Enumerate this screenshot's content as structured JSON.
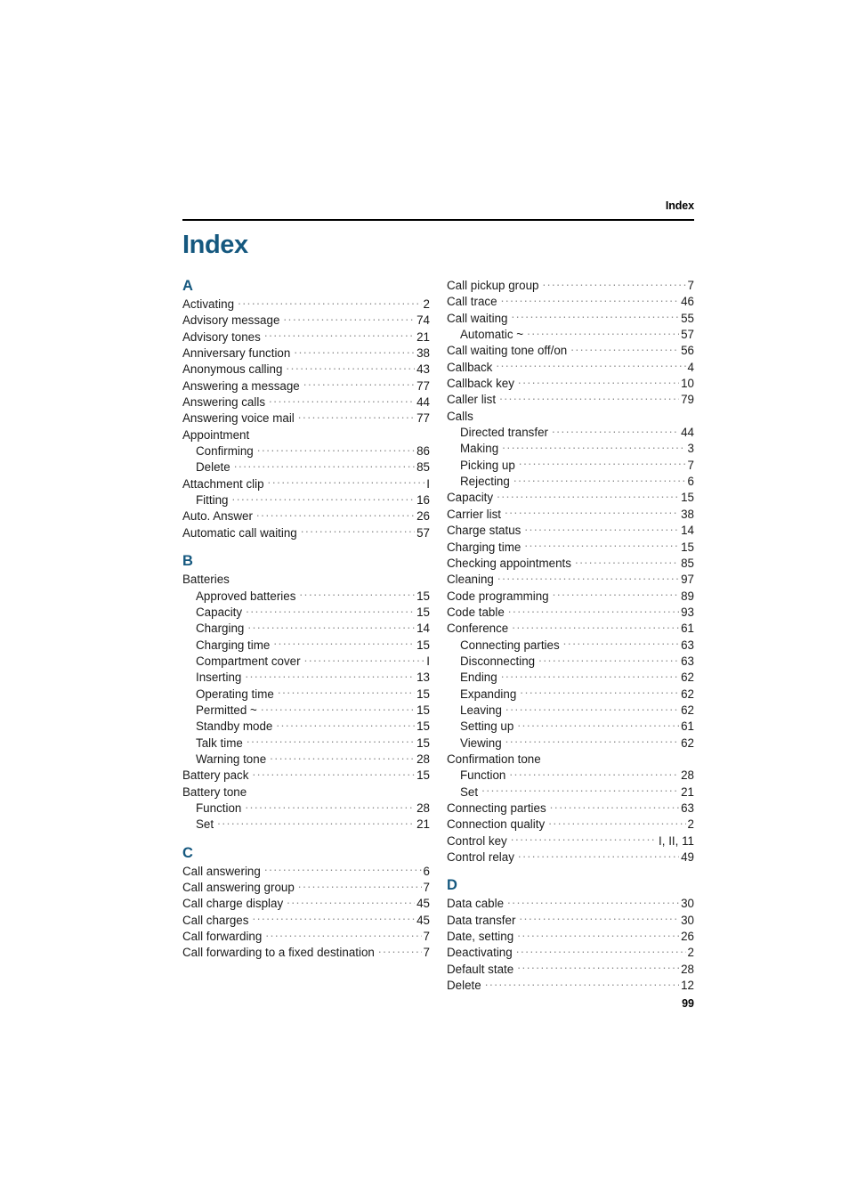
{
  "header": {
    "running_title": "Index"
  },
  "title": "Index",
  "folio": {
    "page_number": "99"
  },
  "colors": {
    "accent_blue": "#15587f",
    "text": "#1a1a1a",
    "leader_dots": "#8c8c8c",
    "rule": "#000000"
  },
  "columns": [
    {
      "name": "left-column",
      "sections": [
        {
          "letter": "A",
          "entries": [
            {
              "label": "Activating",
              "page": "2",
              "sub": false
            },
            {
              "label": "Advisory message",
              "page": "74",
              "sub": false
            },
            {
              "label": "Advisory tones",
              "page": "21",
              "sub": false
            },
            {
              "label": "Anniversary function",
              "page": "38",
              "sub": false
            },
            {
              "label": "Anonymous calling",
              "page": "43",
              "sub": false
            },
            {
              "label": "Answering a message",
              "page": "77",
              "sub": false
            },
            {
              "label": "Answering calls",
              "page": "44",
              "sub": false
            },
            {
              "label": "Answering voice mail",
              "page": "77",
              "sub": false
            },
            {
              "label": "Appointment",
              "page": "",
              "sub": false
            },
            {
              "label": "Confirming",
              "page": "86",
              "sub": true
            },
            {
              "label": "Delete",
              "page": "85",
              "sub": true
            },
            {
              "label": "Attachment clip",
              "page": "I",
              "sub": false
            },
            {
              "label": "Fitting",
              "page": "16",
              "sub": true
            },
            {
              "label": "Auto. Answer",
              "page": "26",
              "sub": false
            },
            {
              "label": "Automatic call waiting",
              "page": "57",
              "sub": false
            }
          ]
        },
        {
          "letter": "B",
          "entries": [
            {
              "label": "Batteries",
              "page": "",
              "sub": false
            },
            {
              "label": "Approved batteries",
              "page": "15",
              "sub": true
            },
            {
              "label": "Capacity",
              "page": "15",
              "sub": true
            },
            {
              "label": "Charging",
              "page": "14",
              "sub": true
            },
            {
              "label": "Charging time",
              "page": "15",
              "sub": true
            },
            {
              "label": "Compartment cover",
              "page": "I",
              "sub": true
            },
            {
              "label": "Inserting",
              "page": "13",
              "sub": true
            },
            {
              "label": "Operating time",
              "page": "15",
              "sub": true
            },
            {
              "label": "Permitted ~",
              "page": "15",
              "sub": true
            },
            {
              "label": "Standby mode",
              "page": "15",
              "sub": true
            },
            {
              "label": "Talk time",
              "page": "15",
              "sub": true
            },
            {
              "label": "Warning tone",
              "page": "28",
              "sub": true
            },
            {
              "label": "Battery pack",
              "page": "15",
              "sub": false
            },
            {
              "label": "Battery tone",
              "page": "",
              "sub": false
            },
            {
              "label": "Function",
              "page": "28",
              "sub": true
            },
            {
              "label": "Set",
              "page": "21",
              "sub": true
            }
          ]
        },
        {
          "letter": "C",
          "entries": [
            {
              "label": "Call answering",
              "page": "6",
              "sub": false
            },
            {
              "label": "Call answering group",
              "page": "7",
              "sub": false
            },
            {
              "label": "Call charge display",
              "page": "45",
              "sub": false
            },
            {
              "label": "Call charges",
              "page": "45",
              "sub": false
            },
            {
              "label": "Call forwarding",
              "page": "7",
              "sub": false
            },
            {
              "label": "Call forwarding to a fixed destination",
              "page": "7",
              "sub": false
            }
          ]
        }
      ]
    },
    {
      "name": "right-column",
      "sections": [
        {
          "letter": "",
          "entries": [
            {
              "label": "Call pickup group",
              "page": "7",
              "sub": false
            },
            {
              "label": "Call trace",
              "page": "46",
              "sub": false
            },
            {
              "label": "Call waiting",
              "page": "55",
              "sub": false
            },
            {
              "label": "Automatic ~",
              "page": "57",
              "sub": true
            },
            {
              "label": "Call waiting tone off/on",
              "page": "56",
              "sub": false
            },
            {
              "label": "Callback",
              "page": "4",
              "sub": false
            },
            {
              "label": "Callback key",
              "page": "10",
              "sub": false
            },
            {
              "label": "Caller list",
              "page": "79",
              "sub": false
            },
            {
              "label": "Calls",
              "page": "",
              "sub": false
            },
            {
              "label": "Directed transfer",
              "page": "44",
              "sub": true
            },
            {
              "label": "Making",
              "page": "3",
              "sub": true
            },
            {
              "label": "Picking up",
              "page": "7",
              "sub": true
            },
            {
              "label": "Rejecting",
              "page": "6",
              "sub": true
            },
            {
              "label": "Capacity",
              "page": "15",
              "sub": false
            },
            {
              "label": "Carrier list",
              "page": "38",
              "sub": false
            },
            {
              "label": "Charge status",
              "page": "14",
              "sub": false
            },
            {
              "label": "Charging time",
              "page": "15",
              "sub": false
            },
            {
              "label": "Checking appointments",
              "page": "85",
              "sub": false
            },
            {
              "label": "Cleaning",
              "page": "97",
              "sub": false
            },
            {
              "label": "Code programming",
              "page": "89",
              "sub": false
            },
            {
              "label": "Code table",
              "page": "93",
              "sub": false
            },
            {
              "label": "Conference",
              "page": "61",
              "sub": false
            },
            {
              "label": "Connecting parties",
              "page": "63",
              "sub": true
            },
            {
              "label": "Disconnecting",
              "page": "63",
              "sub": true
            },
            {
              "label": "Ending",
              "page": "62",
              "sub": true
            },
            {
              "label": "Expanding",
              "page": "62",
              "sub": true
            },
            {
              "label": "Leaving",
              "page": "62",
              "sub": true
            },
            {
              "label": "Setting up",
              "page": "61",
              "sub": true
            },
            {
              "label": "Viewing",
              "page": "62",
              "sub": true
            },
            {
              "label": "Confirmation tone",
              "page": "",
              "sub": false
            },
            {
              "label": "Function",
              "page": "28",
              "sub": true
            },
            {
              "label": "Set",
              "page": "21",
              "sub": true
            },
            {
              "label": "Connecting parties",
              "page": "63",
              "sub": false
            },
            {
              "label": "Connection quality",
              "page": "2",
              "sub": false
            },
            {
              "label": "Control key",
              "page": "I, II, 11",
              "sub": false
            },
            {
              "label": "Control relay",
              "page": "49",
              "sub": false
            }
          ]
        },
        {
          "letter": "D",
          "entries": [
            {
              "label": "Data cable",
              "page": "30",
              "sub": false
            },
            {
              "label": "Data transfer",
              "page": "30",
              "sub": false
            },
            {
              "label": "Date, setting",
              "page": "26",
              "sub": false
            },
            {
              "label": "Deactivating",
              "page": "2",
              "sub": false
            },
            {
              "label": "Default state",
              "page": "28",
              "sub": false
            },
            {
              "label": "Delete",
              "page": "12",
              "sub": false
            }
          ]
        }
      ]
    }
  ]
}
